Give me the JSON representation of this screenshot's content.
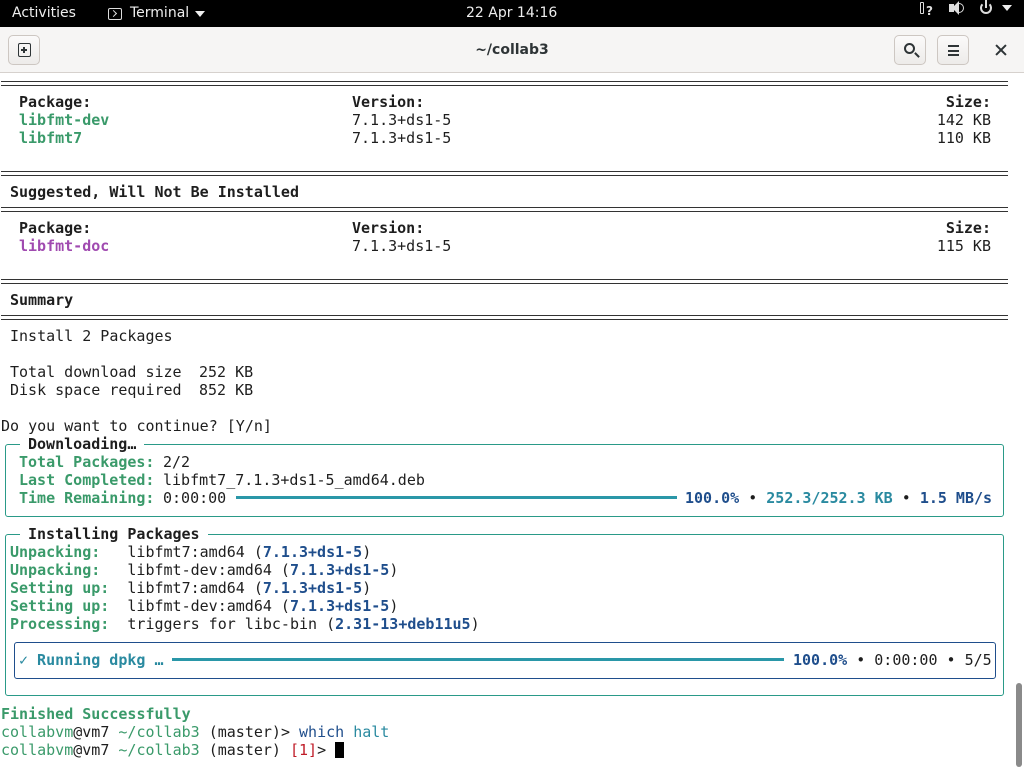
{
  "topbar": {
    "activities": "Activities",
    "app_name": "Terminal",
    "clock": "22 Apr  14:16",
    "tray_icons": [
      "network-icon",
      "volume-icon",
      "power-icon"
    ]
  },
  "window": {
    "title": "~/collab3",
    "buttons": [
      "new-tab-icon",
      "search-icon",
      "menu-icon",
      "close-icon"
    ]
  },
  "colors": {
    "package_new": "#3a9a6a",
    "package_suggested": "#a04ab0",
    "accent_blue": "#1f4e8c",
    "progress": "#2a97a8",
    "box_border": "#2a9a88"
  },
  "terminal": {
    "install_table": {
      "headers": [
        "Package:",
        "Version:",
        "Size:"
      ],
      "rows": [
        {
          "package": "libfmt-dev",
          "version": "7.1.3+ds1-5",
          "size": "142 KB"
        },
        {
          "package": "libfmt7",
          "version": "7.1.3+ds1-5",
          "size": "110 KB"
        }
      ]
    },
    "suggested_heading": "Suggested, Will Not Be Installed",
    "suggested_table": {
      "headers": [
        "Package:",
        "Version:",
        "Size:"
      ],
      "rows": [
        {
          "package": "libfmt-doc",
          "version": "7.1.3+ds1-5",
          "size": "115 KB"
        }
      ]
    },
    "summary_heading": "Summary",
    "summary": {
      "install_line": "Install 2 Packages",
      "download_label": "Total download size",
      "download_value": "252 KB",
      "disk_label": "Disk space required",
      "disk_value": "852 KB"
    },
    "prompt_line": "Do you want to continue? [Y/n]",
    "downloading": {
      "title": "Downloading…",
      "total_label": "Total Packages:",
      "total_value": "2/2",
      "last_label": "Last Completed:",
      "last_value": "libfmt7_7.1.3+ds1-5_amd64.deb",
      "time_label": "Time Remaining:",
      "time_value": "0:00:00",
      "progress_fraction": 1.0,
      "percent": "100.0%",
      "bytes": "252.3/252.3 KB",
      "speed": "1.5 MB/s",
      "bullet": "•"
    },
    "installing": {
      "title": "Installing Packages",
      "lines": [
        {
          "action": "Unpacking:",
          "pad": "  ",
          "target": "libfmt7:amd64",
          "version": "7.1.3+ds1-5"
        },
        {
          "action": "Unpacking:",
          "pad": "  ",
          "target": "libfmt-dev:amd64",
          "version": "7.1.3+ds1-5"
        },
        {
          "action": "Setting up:",
          "pad": " ",
          "target": "libfmt7:amd64",
          "version": "7.1.3+ds1-5"
        },
        {
          "action": "Setting up:",
          "pad": " ",
          "target": "libfmt-dev:amd64",
          "version": "7.1.3+ds1-5"
        },
        {
          "action": "Processing:",
          "pad": " ",
          "target": "triggers for libc-bin",
          "version": "2.31-13+deb11u5"
        }
      ],
      "running_label": "✓ Running dpkg …",
      "progress_fraction": 1.0,
      "percent": "100.0%",
      "time": "0:00:00",
      "count": "5/5",
      "bullet": "•"
    },
    "finished": "Finished Successfully",
    "shell": {
      "user": "collabvm",
      "at": "@",
      "host": "vm7",
      "path": "~/collab3",
      "branch": "(master)",
      "arrow": ">",
      "command1": "which",
      "command1_arg": "halt",
      "exit_code": "[1]"
    }
  }
}
